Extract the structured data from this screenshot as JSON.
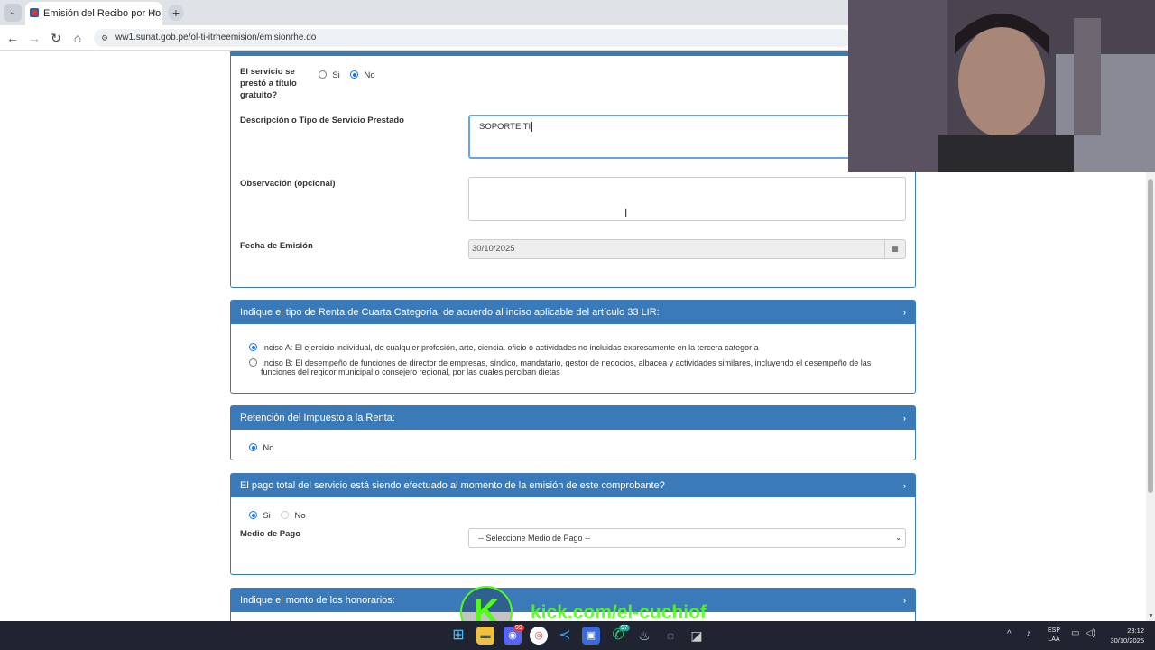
{
  "browser": {
    "tab_title": "Emisión del Recibo por Honorarios",
    "url": "ww1.sunat.gob.pe/ol-ti-itrheemision/emisionrhe.do"
  },
  "form": {
    "gratuito": {
      "label": "El servicio se prestó a título gratuito?",
      "opt_si": "Si",
      "opt_no": "No",
      "selected": "No"
    },
    "descripcion": {
      "label": "Descripción o Tipo de Servicio Prestado",
      "value": "SOPORTE TI"
    },
    "observacion": {
      "label": "Observación (opcional)",
      "value": ""
    },
    "fecha": {
      "label": "Fecha de Emisión",
      "value": "30/10/2025"
    }
  },
  "renta_panel": {
    "title": "Indique el tipo de Renta de Cuarta Categoría, de acuerdo al inciso aplicable del artículo 33 LIR:",
    "option_a": "Inciso A: El ejercicio individual, de cualquier profesión, arte, ciencia, oficio o actividades no incluidas expresamente en la tercera categoría",
    "option_b_line1": "Inciso B: El desempeño de funciones de director de empresas, síndico, mandatario, gestor de negocios, albacea y actividades similares, incluyendo el desempeño de las",
    "option_b_line2": "funciones del regidor municipal o consejero regional, por las cuales perciban dietas",
    "selected": "Inciso A"
  },
  "retencion_panel": {
    "title": "Retención del Impuesto a la Renta:",
    "option_no": "No"
  },
  "pago_panel": {
    "title": "El pago total del servicio está siendo efectuado al momento de la emisión de este comprobante?",
    "opt_si": "Si",
    "opt_no": "No",
    "selected": "Si",
    "medio_label": "Medio de Pago",
    "medio_value": "-- Seleccione Medio de Pago --"
  },
  "honorarios_panel": {
    "title": "Indique el monto de los honorarios:"
  },
  "overlay": {
    "watermark": "kick.com/el-cuchiof",
    "logo_letter": "K"
  },
  "taskbar": {
    "lang_line1": "ESP",
    "lang_line2": "LAA",
    "time": "23:12",
    "date": "30/10/2025",
    "badge_discord": "99",
    "badge_whatsapp": "97"
  },
  "colors": {
    "panel_header": "#3a7ab8",
    "radio_accent": "#1a73e8",
    "taskbar": "#1f2430",
    "watermark": "#53fc18"
  }
}
